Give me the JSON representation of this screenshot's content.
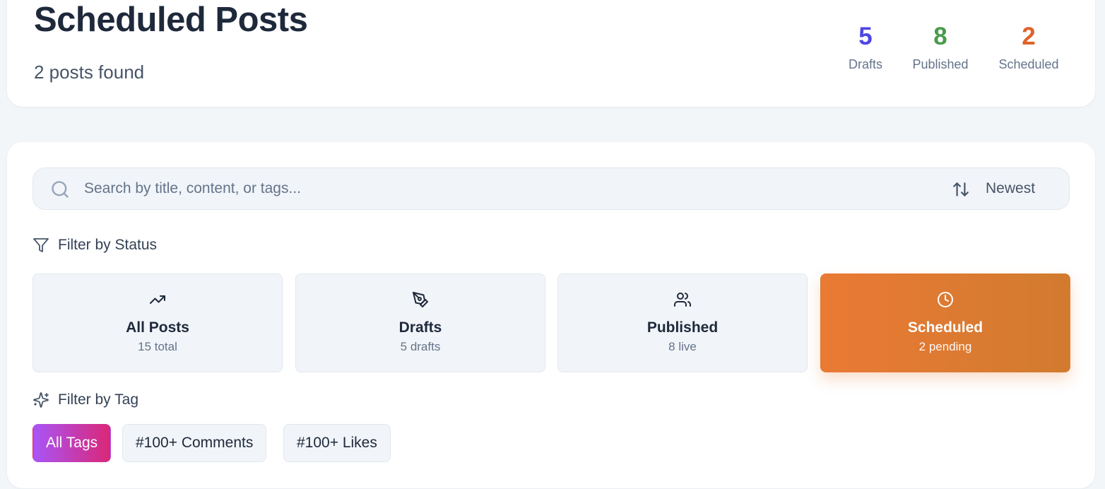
{
  "header": {
    "title": "Scheduled Posts",
    "subtitle": "2 posts found",
    "stats": [
      {
        "value": "5",
        "label": "Drafts",
        "color": "#4f46e5"
      },
      {
        "value": "8",
        "label": "Published",
        "color": "#4a9a4c"
      },
      {
        "value": "2",
        "label": "Scheduled",
        "color": "#e0622a"
      }
    ]
  },
  "search": {
    "placeholder": "Search by title, content, or tags...",
    "value": "",
    "sort_label": "Newest"
  },
  "status_filter": {
    "label": "Filter by Status",
    "options": [
      {
        "title": "All Posts",
        "sub": "15 total",
        "icon": "trending-up-icon",
        "active": false
      },
      {
        "title": "Drafts",
        "sub": "5 drafts",
        "icon": "pen-tool-icon",
        "active": false
      },
      {
        "title": "Published",
        "sub": "8 live",
        "icon": "users-icon",
        "active": false
      },
      {
        "title": "Scheduled",
        "sub": "2 pending",
        "icon": "clock-icon",
        "active": true
      }
    ]
  },
  "tag_filter": {
    "label": "Filter by Tag",
    "tags": [
      {
        "label": "All Tags",
        "active": true
      },
      {
        "label": "#100+ Comments",
        "active": false
      },
      {
        "label": "#100+ Likes",
        "active": false
      }
    ]
  },
  "colors": {
    "accent_orange": "#ea7a34",
    "accent_purple": "#a855f7",
    "accent_pink": "#db2777"
  }
}
